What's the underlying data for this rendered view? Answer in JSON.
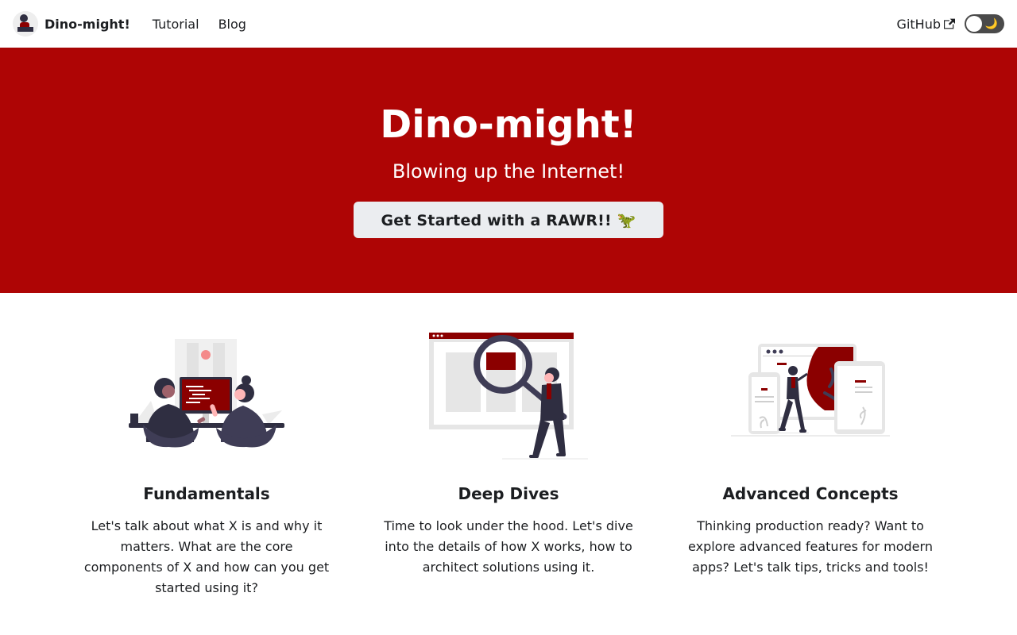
{
  "nav": {
    "brand": "Dino-might!",
    "links": [
      "Tutorial",
      "Blog"
    ],
    "github": "GitHub",
    "theme_toggle_glyph": "🌙"
  },
  "hero": {
    "title": "Dino-might!",
    "subtitle": "Blowing up the Internet!",
    "button": "Get Started with a RAWR!! 🦖"
  },
  "features": [
    {
      "title": "Fundamentals",
      "text": "Let's talk about what X is and why it matters. What are the core components of X and how can you get started using it?",
      "illustration": "pair-programming-illustration"
    },
    {
      "title": "Deep Dives",
      "text": "Time to look under the hood. Let's dive into the details of how X works, how to architect solutions using it.",
      "illustration": "magnifying-glass-illustration"
    },
    {
      "title": "Advanced Concepts",
      "text": "Thinking production ready? Want to explore advanced features for modern apps? Let's talk tips, tricks and tools!",
      "illustration": "multi-device-illustration"
    }
  ],
  "colors": {
    "primary": "#ae0505",
    "button_bg": "#ebedf0",
    "text": "#1c1e21",
    "illustration_dark": "#2f2e41",
    "illustration_grey": "#e6e6e6"
  }
}
